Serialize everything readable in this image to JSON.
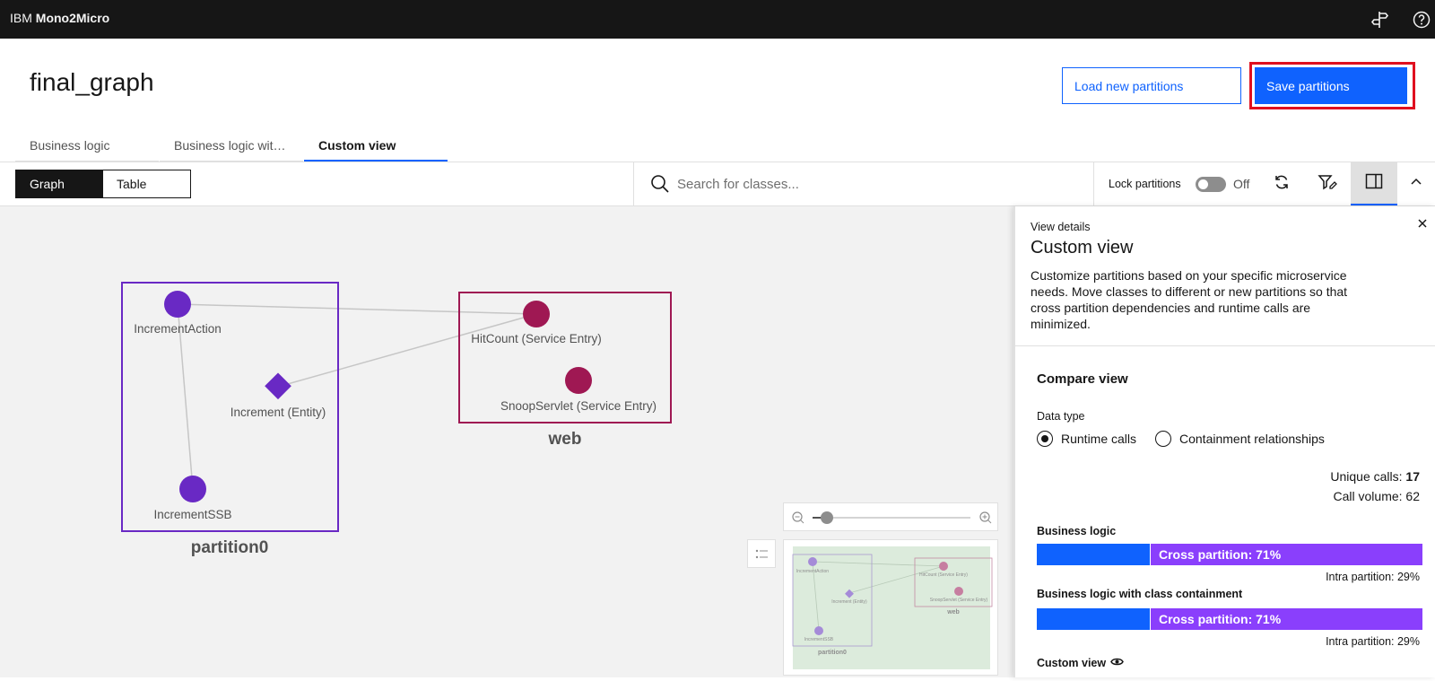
{
  "app": {
    "brand_prefix": "IBM",
    "brand_name": "Mono2Micro"
  },
  "header": {
    "title": "final_graph",
    "load_button": "Load new partitions",
    "save_button": "Save partitions"
  },
  "tabs": [
    {
      "label": "Business logic"
    },
    {
      "label": "Business logic wit…"
    },
    {
      "label": "Custom view"
    }
  ],
  "toolbar": {
    "view_options": [
      "Graph",
      "Table"
    ],
    "selected_view": "Graph",
    "search_placeholder": "Search for classes...",
    "lock_label": "Lock partitions",
    "lock_state": "Off"
  },
  "graph": {
    "partitions": [
      {
        "name": "partition0",
        "color": "#6929c4"
      },
      {
        "name": "web",
        "color": "#9f1853"
      }
    ],
    "nodes": [
      {
        "label": "IncrementAction",
        "partition": "partition0",
        "shape": "circle"
      },
      {
        "label": "Increment (Entity)",
        "partition": "partition0",
        "shape": "diamond"
      },
      {
        "label": "IncrementSSB",
        "partition": "partition0",
        "shape": "circle"
      },
      {
        "label": "HitCount (Service Entry)",
        "partition": "web",
        "shape": "circle"
      },
      {
        "label": "SnoopServlet (Service Entry)",
        "partition": "web",
        "shape": "circle"
      }
    ],
    "edges": [
      [
        "IncrementAction",
        "HitCount (Service Entry)"
      ],
      [
        "IncrementAction",
        "IncrementSSB"
      ],
      [
        "Increment (Entity)",
        "HitCount (Service Entry)"
      ]
    ]
  },
  "panel": {
    "eyebrow": "View details",
    "title": "Custom view",
    "description": "Customize partitions based on your specific microservice needs. Move classes to different or new partitions so that cross partition dependencies and runtime calls are minimized.",
    "compare_title": "Compare view",
    "data_type_label": "Data type",
    "radio_runtime": "Runtime calls",
    "radio_containment": "Containment relationships",
    "selected_data_type": "Runtime calls",
    "unique_calls_label": "Unique calls:",
    "unique_calls_value": "17",
    "call_volume_label": "Call volume:",
    "call_volume_value": "62",
    "bars": [
      {
        "label": "Business logic",
        "cross_text": "Cross partition: 71%",
        "intra_text": "Intra partition: 29%",
        "cross_pct": 71
      },
      {
        "label": "Business logic with class containment",
        "cross_text": "Cross partition: 71%",
        "intra_text": "Intra partition: 29%",
        "cross_pct": 71
      }
    ],
    "custom_view_label": "Custom view"
  }
}
